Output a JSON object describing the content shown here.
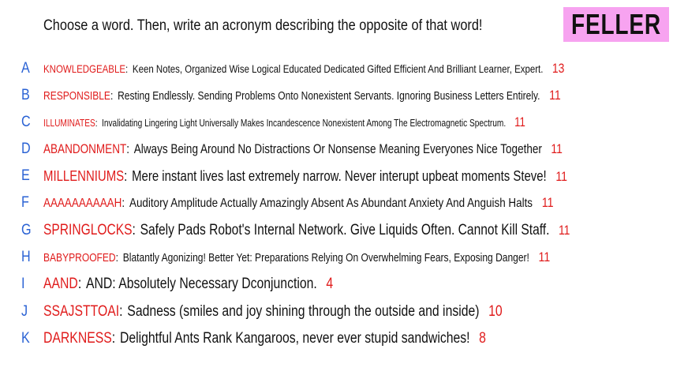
{
  "question": "Choose a word. Then, write an acronym describing the opposite of that word!",
  "logo": "FELLER",
  "entries": [
    {
      "letter": "A",
      "word": "KNOWLEDGEABLE",
      "answer": "Keen Notes, Organized Wise Logical Educated Dedicated Gifted Efficient And Brilliant Learner, Expert.",
      "score": "13"
    },
    {
      "letter": "B",
      "word": "RESPONSIBLE",
      "answer": "Resting Endlessly. Sending Problems Onto Nonexistent Servants. Ignoring Business Letters Entirely.",
      "score": "11"
    },
    {
      "letter": "C",
      "word": "ILLUMINATES",
      "answer": "Invalidating Lingering Light Universally Makes Incandescence Nonexistent Among The Electromagnetic Spectrum.",
      "score": "11"
    },
    {
      "letter": "D",
      "word": "ABANDONMENT",
      "answer": "Always Being Around No Distractions Or Nonsense Meaning Everyones Nice Together",
      "score": "11"
    },
    {
      "letter": "E",
      "word": "MILLENNIUMS",
      "answer": "Mere instant lives last extremely narrow. Never interupt upbeat moments Steve!",
      "score": "11"
    },
    {
      "letter": "F",
      "word": "AAAAAAAAAAH",
      "answer": "Auditory Amplitude Actually Amazingly Absent As Abundant Anxiety And Anguish Halts",
      "score": "11"
    },
    {
      "letter": "G",
      "word": "SPRINGLOCKS",
      "answer": "Safely Pads Robot's Internal Network. Give Liquids Often. Cannot Kill Staff.",
      "score": "11"
    },
    {
      "letter": "H",
      "word": "BABYPROOFED",
      "answer": "Blatantly Agonizing! Better Yet: Preparations Relying On Overwhelming Fears, Exposing Danger!",
      "score": "11"
    },
    {
      "letter": "I",
      "word": "AAND",
      "answer": "AND: Absolutely Necessary Dconjunction.",
      "score": "4"
    },
    {
      "letter": "J",
      "word": "SSAJSTTOAI",
      "answer": "Sadness (smiles and joy shining through the outside and inside)",
      "score": "10"
    },
    {
      "letter": "K",
      "word": "DARKNESS",
      "answer": "Delightful Ants Rank Kangaroos, never ever stupid sandwiches!",
      "score": "8"
    }
  ]
}
